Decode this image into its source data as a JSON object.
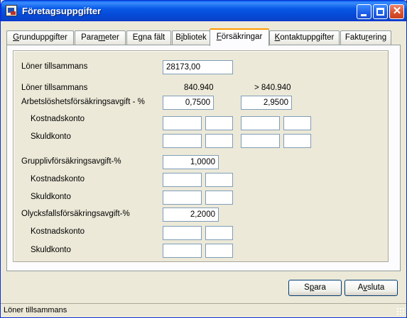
{
  "window": {
    "title": "Företagsuppgifter"
  },
  "tabs": [
    {
      "pre": "",
      "u": "G",
      "post": "runduppgifter"
    },
    {
      "pre": "Para",
      "u": "m",
      "post": "eter"
    },
    {
      "pre": "E",
      "u": "g",
      "post": "na fält"
    },
    {
      "pre": "B",
      "u": "i",
      "post": "bliotek"
    },
    {
      "pre": "",
      "u": "F",
      "post": "örsäkringar"
    },
    {
      "pre": "",
      "u": "K",
      "post": "ontaktuppgifter"
    },
    {
      "pre": "Faktu",
      "u": "r",
      "post": "ering"
    }
  ],
  "active_tab": 4,
  "form": {
    "loner_label": "Löner tillsammans",
    "loner_value": "28173,00",
    "col_header_label": "Löner tillsammans",
    "col1_header": "840.940",
    "col2_header": "> 840.940",
    "arbets_label": "Arbetslöshetsförsäkringsavgift - %",
    "arbets_value1": "0,7500",
    "arbets_value2": "2,9500",
    "kostnad_label": "Kostnadskonto",
    "skuld_label": "Skuldkonto",
    "grupp_label": "Grupplivförsäkringsavgift-%",
    "grupp_value": "1,0000",
    "olycks_label": "Olycksfallsförsäkringsavgift-%",
    "olycks_value": "2,2000"
  },
  "buttons": {
    "save": {
      "pre": "S",
      "u": "p",
      "post": "ara"
    },
    "exit": {
      "pre": "A",
      "u": "v",
      "post": "sluta"
    }
  },
  "status": {
    "text": "Löner tillsammans"
  }
}
